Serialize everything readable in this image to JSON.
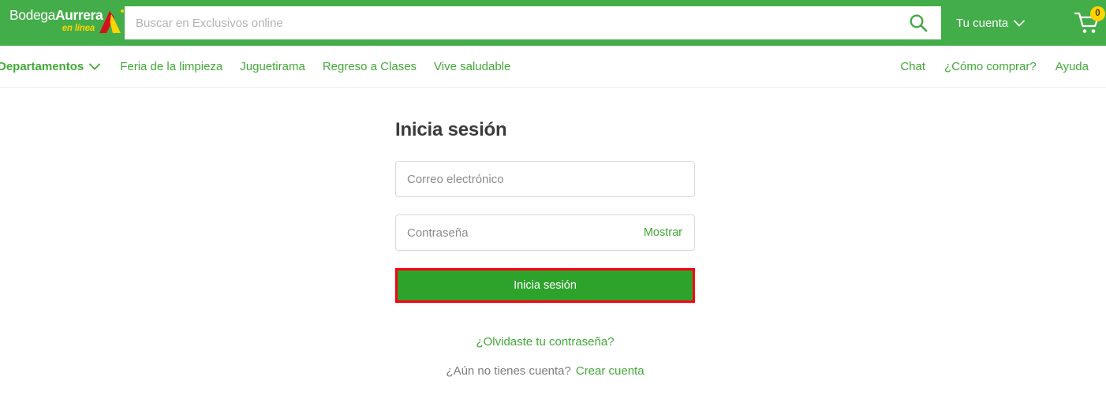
{
  "header": {
    "logo": {
      "brand_part1": "Bodega",
      "brand_part2": "Aurrera",
      "tagline": "en línea",
      "mark_red": "#d3121a",
      "mark_yellow": "#ffd400"
    },
    "search": {
      "placeholder": "Buscar en Exclusivos online",
      "value": "",
      "icon": "search-icon"
    },
    "account_label": "Tu cuenta",
    "account_chevron": "chevron-down-icon",
    "cart": {
      "icon": "shopping-cart-icon",
      "count": "0",
      "badge_color": "#ffd400"
    },
    "background_color": "#43ad4a"
  },
  "nav": {
    "departments_label": "Departamentos",
    "departments_chevron": "chevron-down-icon",
    "left_links": [
      {
        "label": "Feria de la limpieza"
      },
      {
        "label": "Juguetirama"
      },
      {
        "label": "Regreso a Clases"
      },
      {
        "label": "Vive saludable"
      }
    ],
    "right_links": [
      {
        "label": "Chat"
      },
      {
        "label": "¿Cómo comprar?"
      },
      {
        "label": "Ayuda"
      }
    ],
    "link_color": "#41a936"
  },
  "login_form": {
    "title": "Inicia sesión",
    "email": {
      "placeholder": "Correo electrónico",
      "value": ""
    },
    "password": {
      "placeholder": "Contraseña",
      "value": "",
      "show_label": "Mostrar"
    },
    "submit_label": "Inicia sesión",
    "submit_color": "#2ea32b",
    "highlight_color": "#fc0013",
    "forgot_password_label": "¿Olvidaste tu contraseña?",
    "signup_question": "¿Aún no tienes cuenta?",
    "signup_link_label": "Crear cuenta"
  }
}
